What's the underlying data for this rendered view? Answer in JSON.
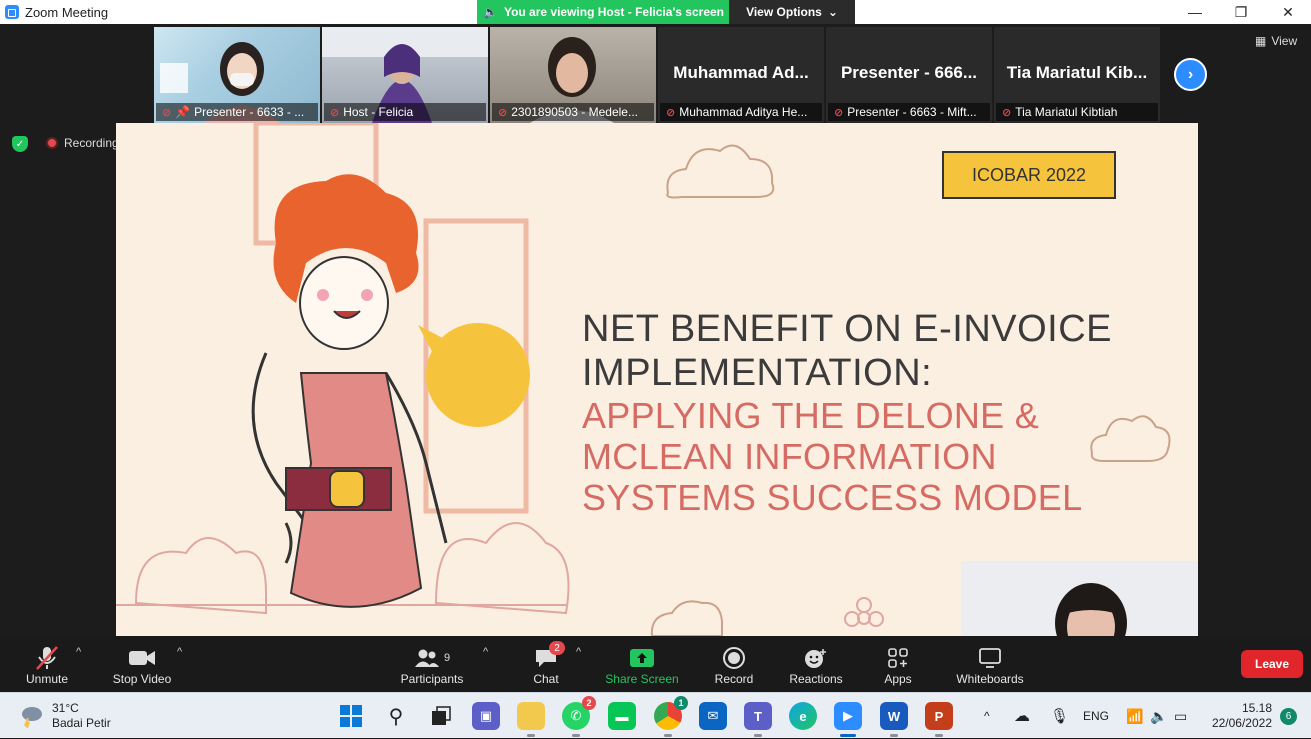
{
  "window": {
    "title": "Zoom Meeting",
    "viewing_banner": "You are viewing Host - Felicia's screen",
    "view_options": "View Options",
    "minimize": "—",
    "restore": "❐",
    "close": "✕"
  },
  "gallery": {
    "tiles": [
      {
        "name": "Presenter - 6633 - ...",
        "big_name": ""
      },
      {
        "name": "Host - Felicia",
        "big_name": ""
      },
      {
        "name": "2301890503 - Medele...",
        "big_name": ""
      },
      {
        "name": "Muhammad Aditya He...",
        "big_name": "Muhammad  Ad..."
      },
      {
        "name": "Presenter - 6663 - Mift...",
        "big_name": "Presenter - 666..."
      },
      {
        "name": "Tia Mariatul Kibtiah",
        "big_name": "Tia Mariatul Kib..."
      }
    ],
    "view_label": "View",
    "next_icon": "chevron-right-icon",
    "recording_label": "Recording"
  },
  "slide": {
    "badge": "ICOBAR 2022",
    "title_line1": "NET BENEFIT ON E-INVOICE",
    "title_line2": "IMPLEMENTATION:",
    "sub_line1": "APPLYING THE DELONE &",
    "sub_line2": "MCLEAN INFORMATION",
    "sub_line3": "SYSTEMS SUCCESS MODEL",
    "title_color": "#3b3b3b",
    "sub_color": "#d56b63",
    "badge_color": "#f6c33d"
  },
  "toolbar": {
    "unmute": "Unmute",
    "stop_video": "Stop Video",
    "participants": "Participants",
    "participants_count": "9",
    "chat": "Chat",
    "chat_badge": "2",
    "share_screen": "Share Screen",
    "record": "Record",
    "reactions": "Reactions",
    "apps": "Apps",
    "whiteboards": "Whiteboards",
    "leave": "Leave",
    "share_color": "#23c55e",
    "leave_color": "#e0262b"
  },
  "taskbar": {
    "weather_temp": "31°C",
    "weather_desc": "Badai Petir",
    "whatsapp_badge": "2",
    "chrome_badge": "1",
    "language": "ENG",
    "time": "15.18",
    "date": "22/06/2022",
    "notifications": "6"
  }
}
